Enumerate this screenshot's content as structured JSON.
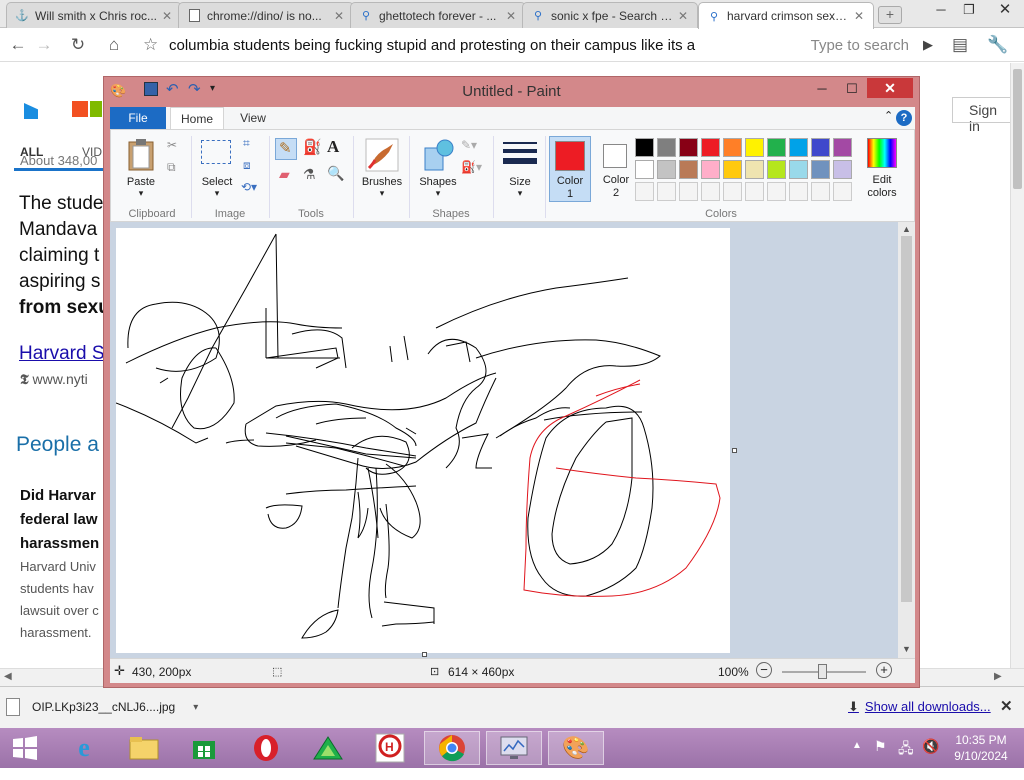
{
  "browser": {
    "tabs": [
      {
        "label": "Will smith x Chris roc...",
        "icon": "youtube-icon"
      },
      {
        "label": "chrome://dino/ is no...",
        "icon": "page-icon"
      },
      {
        "label": "ghettotech forever - ...",
        "icon": "search-icon"
      },
      {
        "label": "sonic x fpe - Search I...",
        "icon": "search-icon"
      },
      {
        "label": "harvard crimson sexu...",
        "icon": "search-icon"
      }
    ],
    "address": "columbia students being fucking stupid and protesting on their campus like its a",
    "search_hint": "Type to search"
  },
  "page": {
    "nav_all": "ALL",
    "nav_video": "VID",
    "results_count": "About 348,00",
    "sign_in": "Sign in",
    "snippet_lines": [
      "The stude",
      "Mandava",
      "claiming t",
      "aspiring s",
      "from sexu"
    ],
    "result_link": "Harvard S",
    "result_url": "www.nyti",
    "people_also": "People a",
    "question_lines": [
      "Did Harvar",
      "federal law",
      "harassmen"
    ],
    "answer_lines": [
      "Harvard Univ",
      "students hav",
      "lawsuit over c",
      "harassment."
    ]
  },
  "downloads": {
    "file": "OIP.LKp3i23__cNLJ6....jpg",
    "show_all": "Show all downloads..."
  },
  "paint": {
    "title": "Untitled - Paint",
    "tabs": {
      "file": "File",
      "home": "Home",
      "view": "View"
    },
    "groups": {
      "clipboard": "Clipboard",
      "image": "Image",
      "tools": "Tools",
      "shapes": "Shapes",
      "colors": "Colors"
    },
    "buttons": {
      "paste": "Paste",
      "select": "Select",
      "brushes": "Brushes",
      "shapes": "Shapes",
      "size": "Size",
      "color1": "Color 1",
      "color1_line1": "Color",
      "color1_line2": "1",
      "color2_line1": "Color",
      "color2_line2": "2",
      "edit_colors_line1": "Edit",
      "edit_colors_line2": "colors"
    },
    "color1": "#ed1c24",
    "color2": "#ffffff",
    "palette_row1": [
      "#000000",
      "#7f7f7f",
      "#880015",
      "#ed1c24",
      "#ff7f27",
      "#fff200",
      "#22b14c",
      "#00a2e8",
      "#3f48cc",
      "#a349a4"
    ],
    "palette_row2": [
      "#ffffff",
      "#c3c3c3",
      "#b97a57",
      "#ffaec9",
      "#ffc90e",
      "#efe4b0",
      "#b5e61d",
      "#99d9ea",
      "#7092be",
      "#c8bfe7"
    ],
    "status": {
      "cursor": "430, 200px",
      "size": "614 × 460px",
      "zoom": "100%"
    }
  },
  "taskbar": {
    "time": "10:35 PM",
    "date": "9/10/2024"
  }
}
